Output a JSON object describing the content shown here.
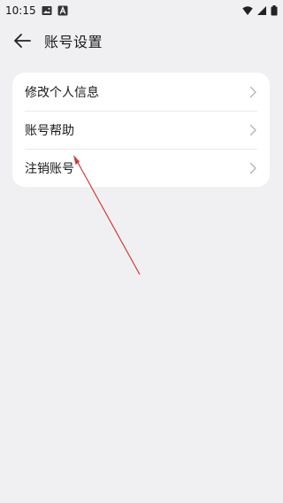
{
  "status_bar": {
    "time": "10:15",
    "icons": [
      "image-icon",
      "text-a-icon",
      "wifi-icon",
      "signal-icon",
      "battery-icon"
    ]
  },
  "header": {
    "title": "账号设置",
    "back_icon": "back-arrow-icon"
  },
  "settings": {
    "items": [
      {
        "label": "修改个人信息",
        "icon": "chevron-right-icon"
      },
      {
        "label": "账号帮助",
        "icon": "chevron-right-icon"
      },
      {
        "label": "注销账号",
        "icon": "chevron-right-icon"
      }
    ]
  },
  "colors": {
    "background": "#f0f0f2",
    "card": "#ffffff",
    "annotation_arrow": "#d23a3a"
  }
}
